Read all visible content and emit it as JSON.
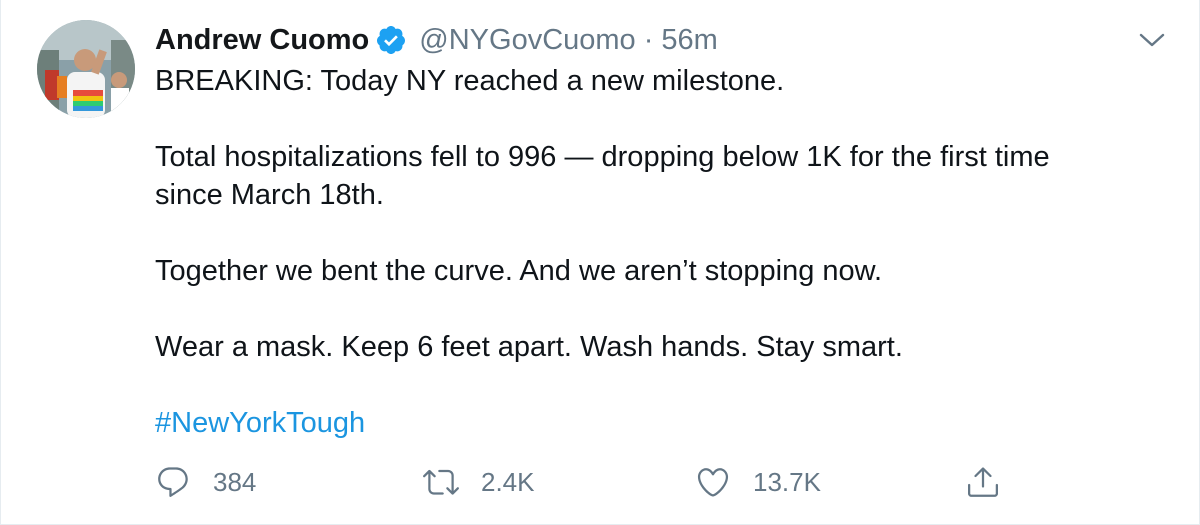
{
  "tweet": {
    "author": {
      "display_name": "Andrew Cuomo",
      "verified": true,
      "handle": "@NYGovCuomo",
      "separator": "·",
      "timestamp": "56m"
    },
    "paragraphs": [
      "BREAKING: Today NY reached a new milestone.",
      "Total hospitalizations fell to 996 — dropping below 1K for the first time\nsince March 18th.",
      "Together we bent the curve. And we aren’t stopping now.",
      "Wear a mask. Keep 6 feet apart. Wash hands. Stay smart."
    ],
    "hashtag": "#NewYorkTough",
    "actions": {
      "reply_count": "384",
      "retweet_count": "2.4K",
      "like_count": "13.7K"
    },
    "icons": {
      "verified": "verified-badge-icon",
      "caret": "chevron-down-icon",
      "reply": "reply-icon",
      "retweet": "retweet-icon",
      "like": "heart-icon",
      "share": "share-icon"
    },
    "colors": {
      "accent": "#1b95e0",
      "muted": "#657786",
      "text": "#0f1419"
    }
  }
}
